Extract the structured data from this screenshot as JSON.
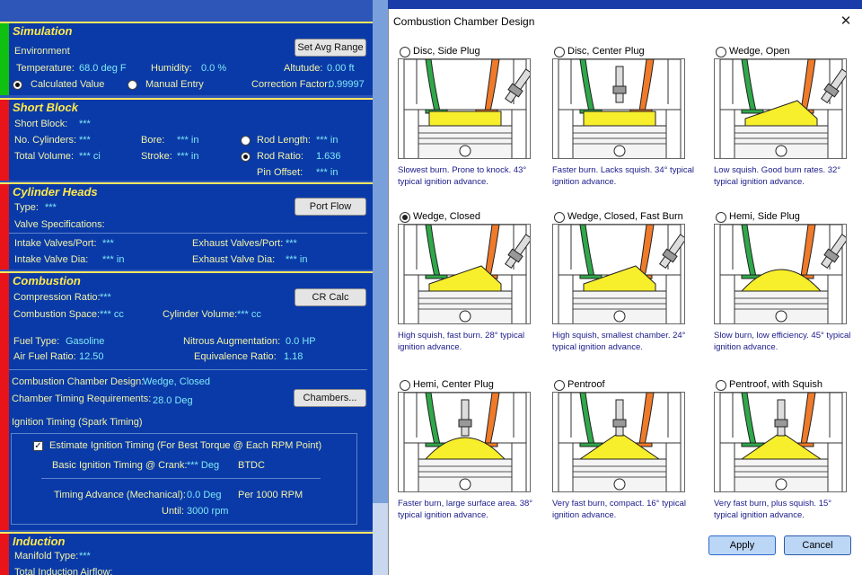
{
  "simulation": {
    "title": "Simulation",
    "environment_label": "Environment",
    "set_avg_range": "Set Avg Range",
    "temperature_label": "Temperature:",
    "temperature_value": "68.0 deg F",
    "humidity_label": "Humidity:",
    "humidity_value": "0.0 %",
    "altitude_label": "Altutude:",
    "altitude_value": "0.00 ft",
    "calculated_label": "Calculated Value",
    "manual_label": "Manual Entry",
    "correction_label": "Correction Factor:",
    "correction_value": "0.99997"
  },
  "short_block": {
    "title": "Short Block",
    "short_block_label": "Short Block:",
    "short_block_value": "***",
    "cylinders_label": "No. Cylinders:",
    "cylinders_value": "***",
    "bore_label": "Bore:",
    "bore_value": "*** in",
    "rod_length_label": "Rod Length:",
    "rod_length_value": "*** in",
    "total_volume_label": "Total Volume:",
    "total_volume_value": "*** ci",
    "stroke_label": "Stroke:",
    "stroke_value": "*** in",
    "rod_ratio_label": "Rod Ratio:",
    "rod_ratio_value": "1.636",
    "pin_offset_label": "Pin Offset:",
    "pin_offset_value": "*** in"
  },
  "cylinder_heads": {
    "title": "Cylinder Heads",
    "type_label": "Type:",
    "type_value": "***",
    "port_flow": "Port Flow",
    "valve_spec_label": "Valve Specifications:",
    "intake_valves_label": "Intake Valves/Port:",
    "intake_valves_value": "***",
    "exhaust_valves_label": "Exhaust Valves/Port:",
    "exhaust_valves_value": "***",
    "intake_dia_label": "Intake Valve Dia:",
    "intake_dia_value": "*** in",
    "exhaust_dia_label": "Exhaust Valve Dia:",
    "exhaust_dia_value": "*** in"
  },
  "combustion": {
    "title": "Combustion",
    "compression_label": "Compression Ratio:",
    "compression_value": "***",
    "cr_calc": "CR Calc",
    "combustion_space_label": "Combustion Space:",
    "combustion_space_value": "*** cc",
    "cylinder_volume_label": "Cylinder Volume:",
    "cylinder_volume_value": "*** cc",
    "fuel_type_label": "Fuel Type:",
    "fuel_type_value": "Gasoline",
    "nitrous_label": "Nitrous Augmentation:",
    "nitrous_value": "0.0 HP",
    "air_fuel_label": "Air Fuel Ratio:",
    "air_fuel_value": "12.50",
    "equivalence_label": "Equivalence Ratio:",
    "equivalence_value": "1.18",
    "chamber_design_label": "Combustion Chamber Design:",
    "chamber_design_value": "Wedge, Closed",
    "chamber_timing_label": "Chamber Timing Requirements:",
    "chamber_timing_value": "28.0 Deg",
    "chambers_button": "Chambers...",
    "ignition_label": "Ignition Timing (Spark Timing)",
    "estimate_label": "Estimate Ignition Timing (For Best Torque @ Each RPM Point)",
    "basic_timing_label": "Basic Ignition Timing @ Crank:",
    "basic_timing_value": "*** Deg",
    "btdc": "BTDC",
    "timing_advance_label": "Timing Advance (Mechanical):",
    "timing_advance_value": "0.0 Deg",
    "per_rpm": "Per 1000 RPM",
    "until_label": "Until:",
    "until_value": "3000 rpm"
  },
  "induction": {
    "title": "Induction",
    "manifold_label": "Manifold Type:",
    "manifold_value": "***",
    "airflow_label": "Total Induction Airflow:"
  },
  "dialog": {
    "title": "Combustion Chamber Design",
    "close_glyph": "✕",
    "apply": "Apply",
    "cancel": "Cancel",
    "options": [
      {
        "name": "Disc, Side Plug",
        "selected": false,
        "desc": "Slowest burn. Prone to knock. 43° typical ignition advance.",
        "shape": "disc",
        "plug": "side"
      },
      {
        "name": "Disc, Center Plug",
        "selected": false,
        "desc": "Faster burn. Lacks squish. 34° typical ignition advance.",
        "shape": "disc",
        "plug": "center"
      },
      {
        "name": "Wedge, Open",
        "selected": false,
        "desc": "Low squish. Good burn rates. 32° typical ignition advance.",
        "shape": "wedge",
        "plug": "side"
      },
      {
        "name": "Wedge, Closed",
        "selected": true,
        "desc": "High squish, fast burn. 28° typical ignition advance.",
        "shape": "wedge",
        "plug": "side"
      },
      {
        "name": "Wedge, Closed, Fast Burn",
        "selected": false,
        "desc": "High squish, smallest chamber. 24° typical ignition advance.",
        "shape": "wedge",
        "plug": "side"
      },
      {
        "name": "Hemi, Side Plug",
        "selected": false,
        "desc": "Slow burn, low efficiency. 45° typical ignition advance.",
        "shape": "hemi",
        "plug": "side"
      },
      {
        "name": "Hemi, Center Plug",
        "selected": false,
        "desc": "Faster burn, large surface area. 38° typical ignition advance.",
        "shape": "hemi",
        "plug": "center"
      },
      {
        "name": "Pentroof",
        "selected": false,
        "desc": "Very fast burn, compact. 16° typical ignition advance.",
        "shape": "pent",
        "plug": "center"
      },
      {
        "name": "Pentroof, with Squish",
        "selected": false,
        "desc": "Very fast burn, plus squish. 15° typical ignition advance.",
        "shape": "pent",
        "plug": "center"
      }
    ]
  },
  "colors": {
    "panel_bg": "#0a3aa8",
    "heading": "#ffe84c",
    "label": "#f2f3a8",
    "value": "#7fe8f6",
    "bar_green": "#10c010",
    "bar_red": "#e8141a",
    "intake_valve": "#2fa84a",
    "exhaust_valve": "#ef7a2a",
    "chamber": "#f7ee2c"
  }
}
